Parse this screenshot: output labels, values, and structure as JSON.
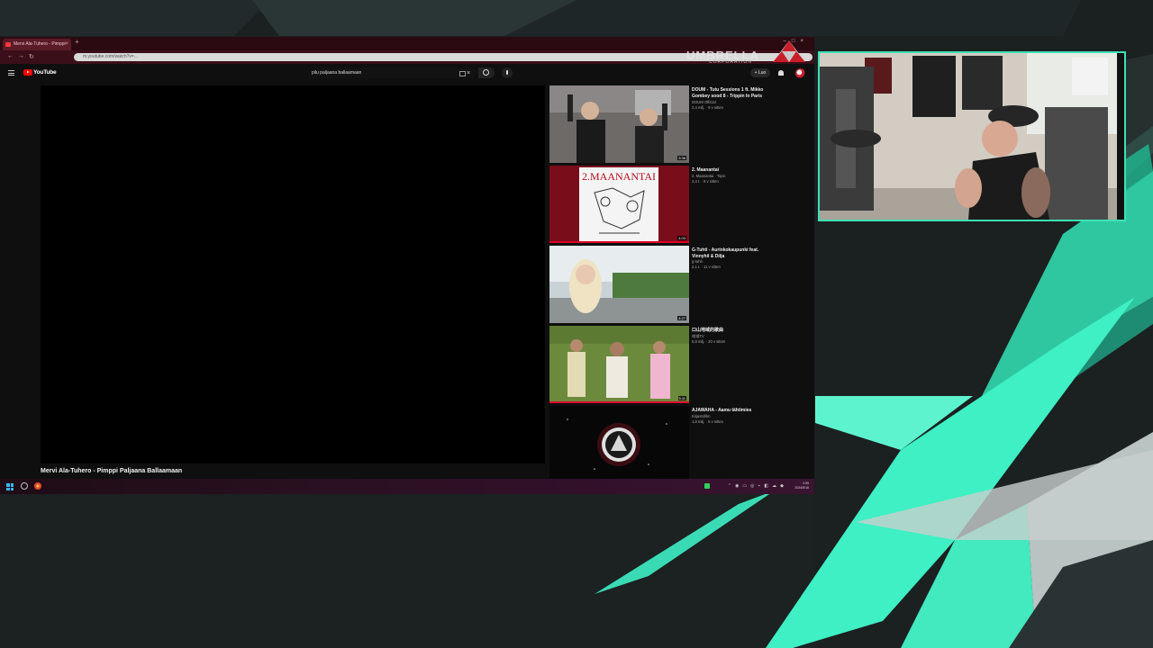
{
  "browser": {
    "tab_title": "Mervi Ala-Tuhero - Pimppi",
    "url": "m.youtube.com/watch?v=...",
    "brand_name": "UMBRELLA",
    "brand_sub": "CORPORATION"
  },
  "youtube": {
    "logo_text": "YouTube",
    "search_query": "pilu paljaana ballaamaan",
    "create_label": "+ Luo",
    "video_title": "Mervi Ala-Tuhero - Pimppi Paljaana Ballaamaan"
  },
  "recommendations": [
    {
      "title": "DOUM - Tutu Sessions 1 ft. Mikko Gombey sood 8 - Trippin In Paris",
      "channel": "DOUM Official",
      "meta": "2,4 milj. · 9 v sitten",
      "duration": "3:36"
    },
    {
      "title": "2. Maanantai",
      "channel": "2. Maanantai · Topic",
      "meta": "3,4 t. · 8 v sitten",
      "duration": "4:03"
    },
    {
      "title": "G-Tuhti - Aurinkokaupunki feat. Vinnyhil & Dilja",
      "channel": "g-tuhti",
      "meta": "2,1 t. · 11 v sitten",
      "duration": "4:27"
    },
    {
      "title": "口山地域的歌曲",
      "channel": "地域TV",
      "meta": "5,8 milj. · 20 v sitten",
      "duration": "5:11"
    },
    {
      "title": "AJAWAHA - Aamu tähtimies",
      "channel": "Kirjastofilm",
      "meta": "1,8 milj. · 5 v sitten",
      "duration": ""
    }
  ],
  "taskbar": {
    "time": "4.59",
    "date": "2024/5/16"
  },
  "colors": {
    "webcam_border": "#3ee0b4",
    "accent_teal": "#3ef0c4",
    "yt_red": "#ff0000"
  }
}
